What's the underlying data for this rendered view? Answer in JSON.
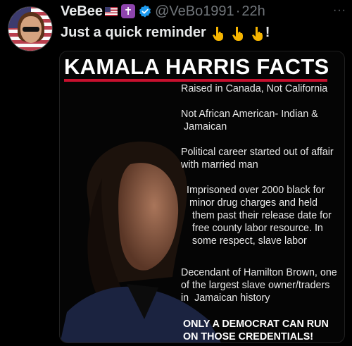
{
  "post": {
    "display_name": "VeBee",
    "handle": "@VeBo1991",
    "separator": "·",
    "time": "22h",
    "text": "Just a quick reminder",
    "punct": "!",
    "more": "···"
  },
  "icons": {
    "flag": "us-flag-icon",
    "cross": "cross-icon",
    "verified": "verified-badge-icon",
    "point": "pointing-down-icon",
    "more": "more-icon"
  },
  "colors": {
    "verified": "#1d9bf0",
    "accent_red": "#c8102e",
    "handle_gray": "#71767b"
  },
  "media": {
    "title": "KAMALA HARRIS FACTS",
    "facts": [
      "Raised in Canada, Not California",
      "Not African American- Indian &\n Jamaican",
      "Political career started out of affair\nwith married man",
      " Imprisoned over 2000 black for\n  minor drug charges and held\n   them past their release date for\n   free county labor resource. In\n   some respect, slave labor",
      "Decendant of Hamilton Brown, one\nof the largest slave owner/traders\nin  Jamaican history"
    ],
    "closing": "ONLY A DEMOCRAT CAN RUN\nON THOSE CREDENTIALS!"
  }
}
